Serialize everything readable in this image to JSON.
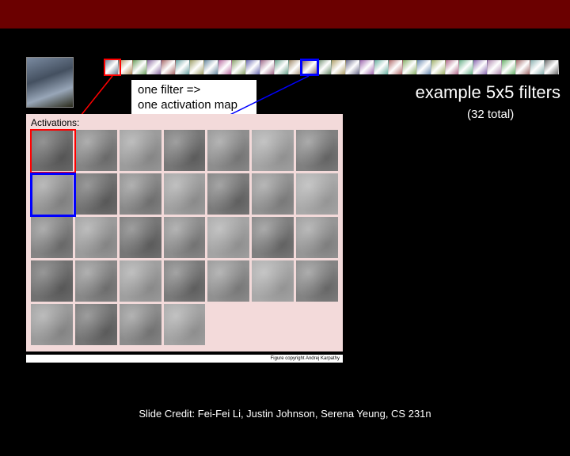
{
  "annotation": {
    "line1": "one filter =>",
    "line2": "one activation map"
  },
  "example": {
    "title": "example 5x5 filters",
    "subtitle": "(32 total)"
  },
  "activations_label": "Activations:",
  "figure_credit": "Figure copyright Andrej Karpathy",
  "slide_credit": "Slide Credit: Fei-Fei Li, Justin Johnson, Serena Yeung, CS 231n",
  "filter_colors": [
    "#6a7a8f",
    "#b08a5a",
    "#6ea060",
    "#8a6aa0",
    "#a86a6a",
    "#6aa0a0",
    "#a0a06a",
    "#6a8aa0",
    "#b86aa0",
    "#8aa06a",
    "#6a6ab0",
    "#a06a8a",
    "#6aa08a",
    "#a08a6a",
    "#8a6a6a",
    "#6a8a6a",
    "#b0a06a",
    "#6a6a8a",
    "#a06ab0",
    "#6ab0a0",
    "#b06a6a",
    "#8ab06a",
    "#6a8ab0",
    "#a0b06a",
    "#b06a8a",
    "#6ab08a",
    "#8a6ab0",
    "#b08ab0",
    "#6ab06a",
    "#a06a6a",
    "#8ab0b0",
    "#6a6a6a"
  ],
  "grid": {
    "cols": 7,
    "rows": 5,
    "blank_cells": [
      32,
      33,
      34
    ]
  },
  "highlight": {
    "red_filter_index": 0,
    "blue_filter_index": 14,
    "red_activation_index": 0,
    "blue_activation_index": 7
  }
}
